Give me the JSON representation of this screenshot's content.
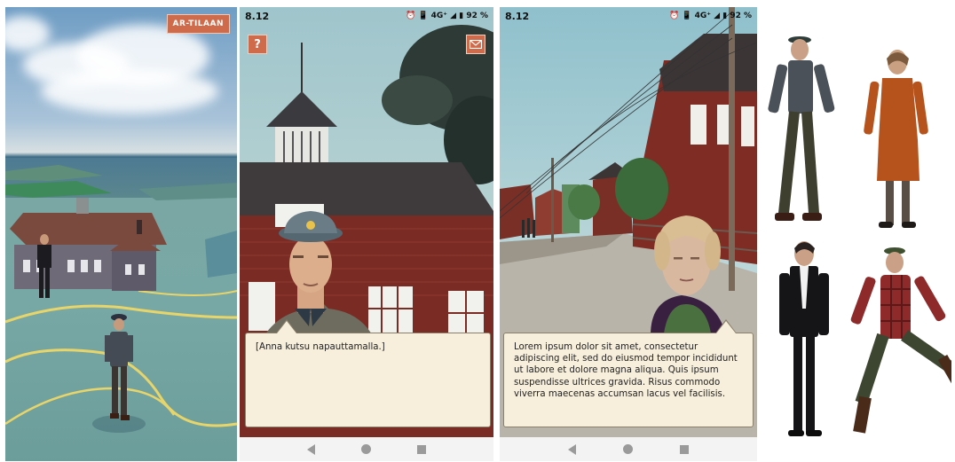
{
  "panel_map": {
    "ar_button": "AR-TILAAN"
  },
  "panel_soldier": {
    "status_time": "8.12",
    "status_icons": "⏰ 📳 4G⁺ ◢ ▮ 92 %",
    "help_button": "?",
    "dialog_text": "[Anna kutsu napauttamalla.]"
  },
  "panel_woman": {
    "status_time": "8.12",
    "status_icons": "⏰ 📳 4G⁺ ◢ ▮ 92 %",
    "dialog_text": "Lorem ipsum dolor sit amet, consectetur\nadipiscing elit, sed do eiusmod tempor incididunt\nut labore et dolore magna aliqua. Quis ipsum\nsuspendisse ultrices gravida. Risus commodo\nviverra maecenas accumsan lacus vel facilisis."
  },
  "icons": {
    "help": "question-icon",
    "mail": "envelope-icon",
    "back": "nav-back-icon",
    "home": "nav-home-icon",
    "recent": "nav-recent-icon"
  },
  "colors": {
    "accent": "#cf6a4a",
    "dialog_bg": "#f7efdc",
    "barn_red": "#7a2b24"
  }
}
